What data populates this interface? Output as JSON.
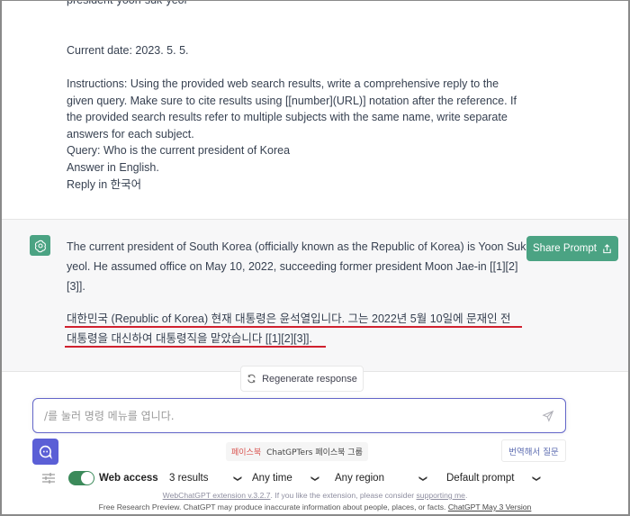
{
  "user_message": {
    "lines": [
      "president-yoon-suk-yeol",
      "",
      "Current date: 2023. 5. 5.",
      "",
      "Instructions: Using the provided web search results, write a comprehensive reply to the",
      "given query. Make sure to cite results using [[number](URL)] notation after the reference. If",
      "the provided search results refer to multiple subjects with the same name, write separate",
      "answers for each subject.",
      "Query: Who is the current president of Korea",
      "Answer in English.",
      "Reply in 한국어"
    ]
  },
  "assistant_message": {
    "avatar_icon": "openai-logo-icon",
    "english_lines": [
      "The current president of South Korea (officially known as the Republic of Korea) is Yoon Suk-",
      "yeol. He assumed office on May 10, 2022, succeeding former president Moon Jae-in [[1][2]",
      "[3]]."
    ],
    "korean_lines": [
      "대한민국 (Republic of Korea) 현재 대통령은 윤석열입니다. 그는 2022년 5월 10일에 문재인 전",
      "대통령을 대신하여 대통령직을 맡았습니다 [[1][2][3]]."
    ],
    "highlight_color": "#d0202e",
    "share_button": {
      "label": "Share Prompt",
      "icon": "share-icon",
      "color": "#4ba383"
    }
  },
  "regenerate_button": {
    "label": "Regenerate response",
    "icon": "refresh-icon"
  },
  "composer": {
    "placeholder": "/를 눌러 명령 메뉴를 엽니다.",
    "value": "",
    "send_icon": "send-icon",
    "border_color": "#6366c9"
  },
  "bot_button": {
    "icon": "prompt-bot-icon",
    "color": "#5b5fd6"
  },
  "banner": {
    "tag": "페이스북",
    "text": "ChatGPTers 페이스북 그룹"
  },
  "translate_button": {
    "label": "번역해서 질문"
  },
  "web_controls": {
    "settings_icon": "sliders-icon",
    "web_access": {
      "label": "Web access",
      "enabled": true
    },
    "results": {
      "selected": "3 results"
    },
    "time": {
      "selected": "Any time"
    },
    "region": {
      "selected": "Any region"
    },
    "prompt": {
      "selected": "Default prompt"
    }
  },
  "footer": {
    "ext_link": "WebChatGPT extension v.3.2.7",
    "ext_text": ". If you like the extension, please consider ",
    "support_link": "supporting me",
    "support_end": ".",
    "disclaimer": "Free Research Preview. ChatGPT may produce inaccurate information about people, places, or facts. ",
    "version_link": "ChatGPT May 3 Version"
  }
}
